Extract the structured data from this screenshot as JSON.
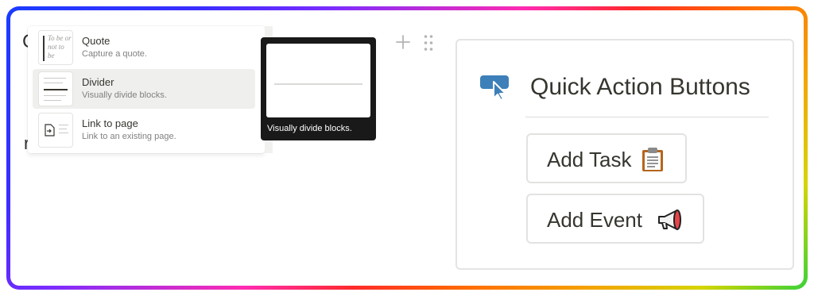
{
  "menu": {
    "items": [
      {
        "title": "Quote",
        "description": "Capture a quote.",
        "thumb_text": "To be or not to be",
        "icon": "quote-thumbnail"
      },
      {
        "title": "Divider",
        "description": "Visually divide blocks.",
        "icon": "divider-thumbnail"
      },
      {
        "title": "Link to page",
        "description": "Link to an existing page.",
        "icon": "link-to-page-thumbnail"
      }
    ],
    "selected_index": 1
  },
  "preview": {
    "caption": "Visually divide blocks."
  },
  "quick_actions": {
    "title": "Quick Action Buttons",
    "icon": "cursor-click-icon",
    "buttons": [
      {
        "label": "Add Task",
        "emoji": "clipboard"
      },
      {
        "label": "Add Event",
        "emoji": "megaphone"
      }
    ]
  },
  "colors": {
    "accent_blue": "#3d7fb8",
    "text": "#37352f",
    "tooltip_bg": "#191919"
  }
}
